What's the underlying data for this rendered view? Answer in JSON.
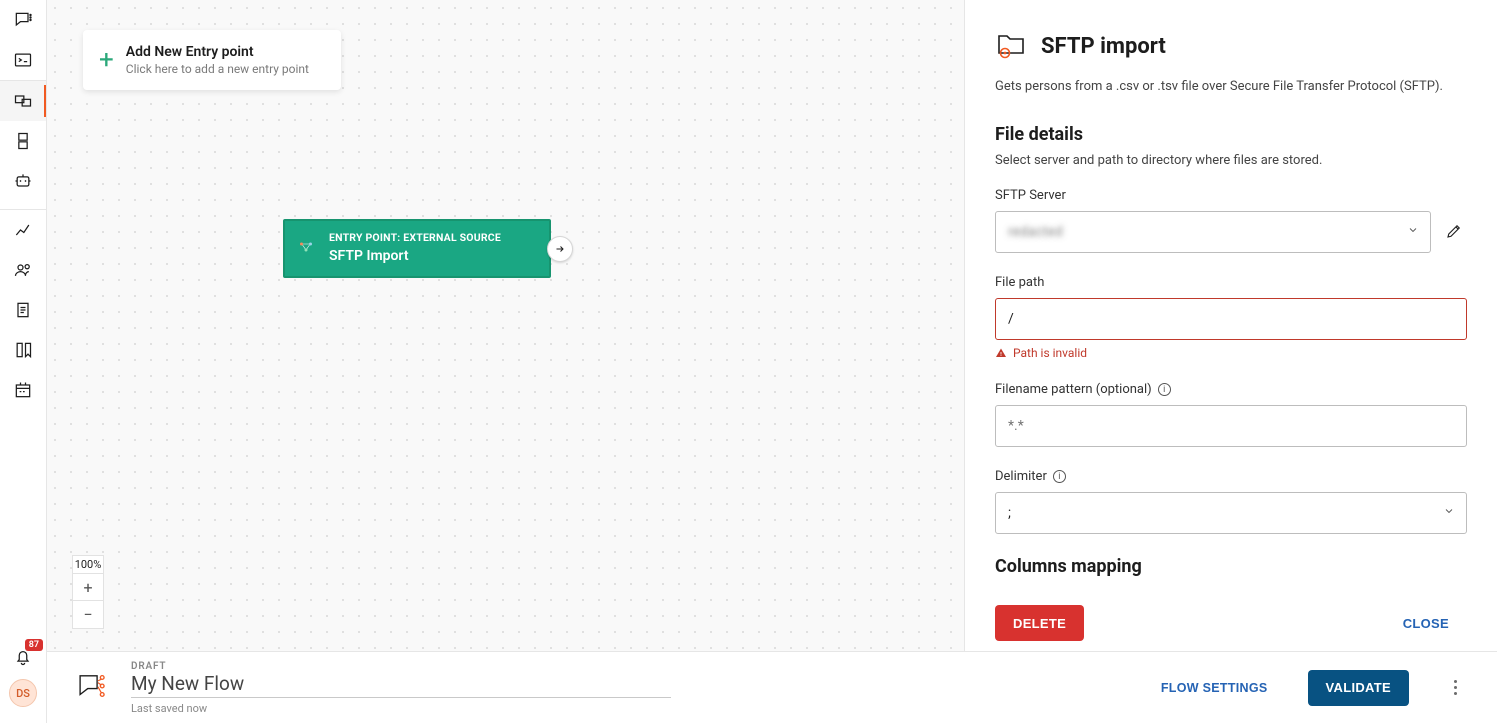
{
  "sidebar": {
    "notification_count": "87",
    "avatar_initials": "DS"
  },
  "canvas": {
    "add_entry": {
      "title": "Add New Entry point",
      "subtitle": "Click here to add a new entry point"
    },
    "node": {
      "eyebrow": "ENTRY POINT: EXTERNAL SOURCE",
      "title": "SFTP Import"
    },
    "zoom": {
      "level": "100%"
    }
  },
  "panel": {
    "title": "SFTP import",
    "description": "Gets persons from a .csv or .tsv file over Secure File Transfer Protocol (SFTP).",
    "file_details": {
      "heading": "File details",
      "subtitle": "Select server and path to directory where files are stored.",
      "sftp_server": {
        "label": "SFTP Server",
        "value": "redacted"
      },
      "file_path": {
        "label": "File path",
        "value": "/",
        "error": "Path is invalid"
      },
      "filename_pattern": {
        "label": "Filename pattern (optional)",
        "placeholder": "*.*"
      },
      "delimiter": {
        "label": "Delimiter",
        "value": ";"
      }
    },
    "columns_mapping": {
      "heading": "Columns mapping"
    },
    "actions": {
      "delete": "DELETE",
      "close": "CLOSE"
    }
  },
  "footer": {
    "status": "DRAFT",
    "flow_name": "My New Flow",
    "saved": "Last saved now",
    "flow_settings": "FLOW SETTINGS",
    "validate": "VALIDATE"
  }
}
